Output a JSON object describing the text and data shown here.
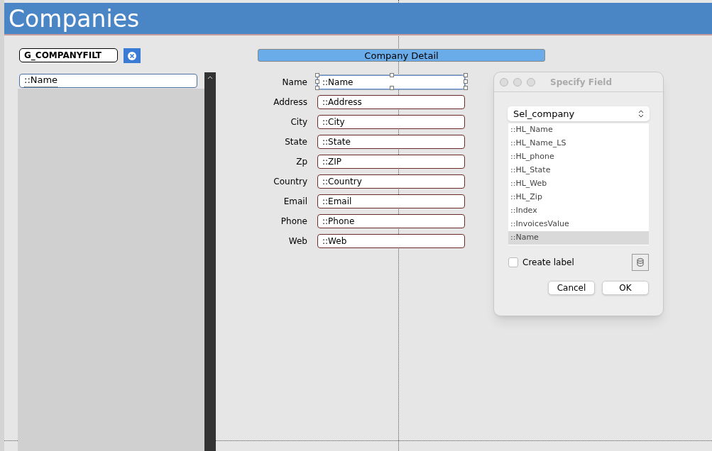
{
  "header": {
    "title": "Companies"
  },
  "filter_field": {
    "value": "G_COMPANYFILT"
  },
  "portal_field": {
    "value": "::Name"
  },
  "section_title": "Company Detail",
  "fields": [
    {
      "label": "Name",
      "value": "::Name",
      "selected": true
    },
    {
      "label": "Address",
      "value": "::Address",
      "selected": false
    },
    {
      "label": "City",
      "value": "::City",
      "selected": false
    },
    {
      "label": "State",
      "value": "::State",
      "selected": false
    },
    {
      "label": "Zp",
      "value": "::ZIP",
      "selected": false
    },
    {
      "label": "Country",
      "value": "::Country",
      "selected": false
    },
    {
      "label": "Email",
      "value": "::Email",
      "selected": false
    },
    {
      "label": "Phone",
      "value": "::Phone",
      "selected": false
    },
    {
      "label": "Web",
      "value": "::Web",
      "selected": false
    }
  ],
  "dialog": {
    "title": "Specify Field",
    "table_select": "Sel_company",
    "items": [
      {
        "label": "::HL_Name",
        "selected": false
      },
      {
        "label": "::HL_Name_LS",
        "selected": false
      },
      {
        "label": "::HL_phone",
        "selected": false
      },
      {
        "label": "::HL_State",
        "selected": false
      },
      {
        "label": "::HL_Web",
        "selected": false
      },
      {
        "label": "::HL_Zip",
        "selected": false
      },
      {
        "label": "::Index",
        "selected": false
      },
      {
        "label": "::InvoicesValue",
        "selected": false
      },
      {
        "label": "::Name",
        "selected": true
      }
    ],
    "create_label": {
      "label": "Create label",
      "checked": false
    },
    "buttons": [
      "Cancel",
      "OK"
    ]
  }
}
